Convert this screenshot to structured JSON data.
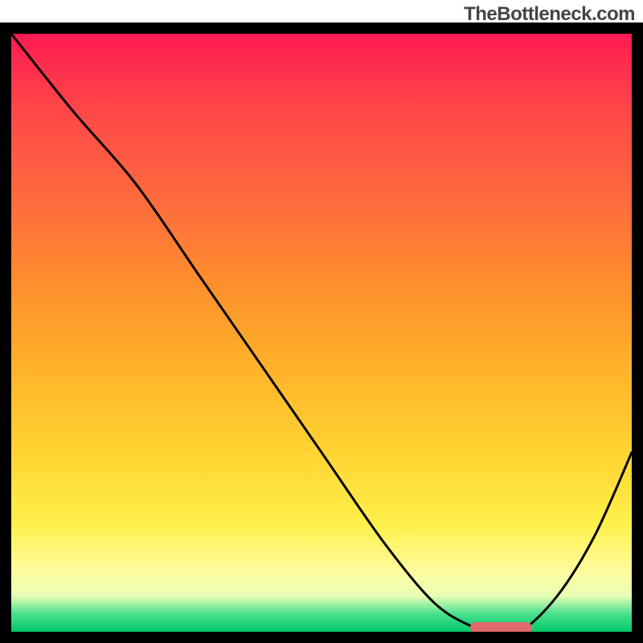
{
  "watermark": "TheBottleneck.com",
  "chart_data": {
    "type": "line",
    "title": "",
    "xlabel": "",
    "ylabel": "",
    "xlim": [
      0,
      100
    ],
    "ylim": [
      0,
      100
    ],
    "grid": false,
    "background_gradient_stops": [
      {
        "pos": 0,
        "color": "#ff1a52"
      },
      {
        "pos": 12,
        "color": "#ff4549"
      },
      {
        "pos": 28,
        "color": "#ff6b3e"
      },
      {
        "pos": 40,
        "color": "#ff8a2e"
      },
      {
        "pos": 55,
        "color": "#ffb02a"
      },
      {
        "pos": 70,
        "color": "#ffd432"
      },
      {
        "pos": 82,
        "color": "#fff04a"
      },
      {
        "pos": 90,
        "color": "#fffca0"
      },
      {
        "pos": 94,
        "color": "#e7ffb4"
      },
      {
        "pos": 97,
        "color": "#4be08e"
      },
      {
        "pos": 100,
        "color": "#00c96a"
      }
    ],
    "series": [
      {
        "name": "bottleneck-curve",
        "x": [
          0,
          10,
          20,
          30,
          40,
          50,
          60,
          68,
          74,
          78,
          82,
          88,
          94,
          100
        ],
        "y": [
          100,
          87,
          75,
          60,
          45,
          30,
          15,
          5,
          1,
          0,
          0,
          6,
          16,
          30
        ]
      }
    ],
    "optimal_marker": {
      "x_start": 74,
      "x_end": 84,
      "y": 0,
      "color": "#e06a6a"
    }
  }
}
